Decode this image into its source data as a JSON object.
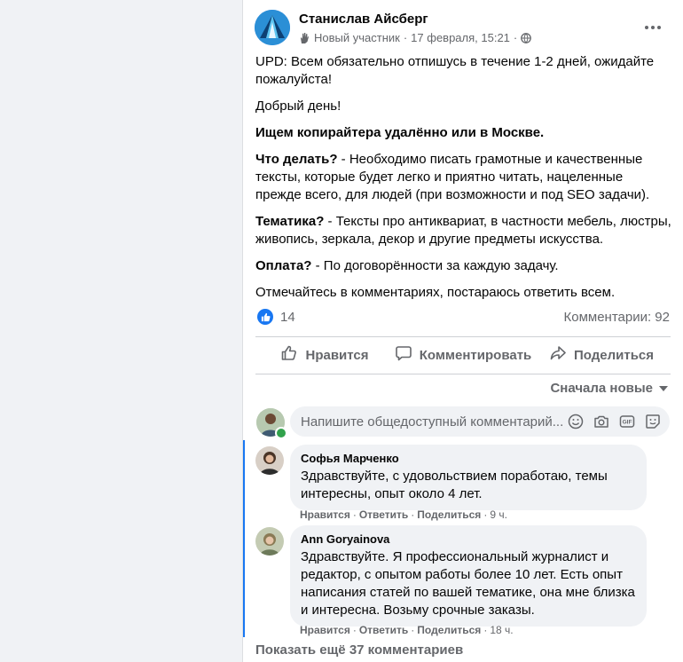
{
  "post": {
    "author": "Станислав Айсберг",
    "badge": "Новый участник",
    "date": "17 февраля, 15:21",
    "paragraphs": {
      "upd": "UPD: Всем обязательно отпишусь в течение 1-2 дней, ожидайте пожалуйста!",
      "greeting": "Добрый день!",
      "headline": "Ищем копирайтера удалённо или в Москве.",
      "what_label": "Что делать?",
      "what_text": " - Необходимо писать грамотные и качественные тексты, которые будет легко и приятно читать, нацеленные прежде всего, для людей (при возможности и под SEO задачи).",
      "topic_label": "Тематика?",
      "topic_text": " - Тексты про антиквариат, в частности мебель, люстры, живопись, зеркала, декор и другие предметы искусства.",
      "pay_label": "Оплата?",
      "pay_text": " - По договорённости за каждую задачу.",
      "closing": "Отмечайтесь в комментариях, постараюсь ответить всем."
    },
    "likes": "14",
    "comments_count": "Комментарии: 92"
  },
  "actions": {
    "like": "Нравится",
    "comment": "Комментировать",
    "share": "Поделиться"
  },
  "sort_label": "Сначала новые",
  "comment_input": {
    "placeholder": "Напишите общедоступный комментарий..."
  },
  "comments": [
    {
      "name": "Софья Марченко",
      "text": "Здравствуйте, с удовольствием поработаю, темы интересны, опыт около 4 лет.",
      "like": "Нравится",
      "reply": "Ответить",
      "share": "Поделиться",
      "time": "9 ч."
    },
    {
      "name": "Ann Goryainova",
      "text": "Здравствуйте. Я профессиональный журналист и редактор, с опытом работы более 10 лет. Есть опыт написания статей по вашей тематике, она мне близка и интересна. Возьму срочные заказы.",
      "like": "Нравится",
      "reply": "Ответить",
      "share": "Поделиться",
      "time": "18 ч."
    }
  ],
  "more_comments": "Показать ещё 37 комментариев",
  "colors": {
    "accent": "#1877f2",
    "text": "#050505",
    "secondary": "#65676b",
    "bubble": "#f0f2f5",
    "online": "#31a24c"
  },
  "icons": [
    "globe-icon",
    "new-member-hand-icon",
    "more-options-icon",
    "like-reaction-icon",
    "thumbs-up-icon",
    "comment-icon",
    "share-icon",
    "chevron-down-icon",
    "emoji-icon",
    "camera-icon",
    "gif-icon",
    "sticker-icon"
  ]
}
